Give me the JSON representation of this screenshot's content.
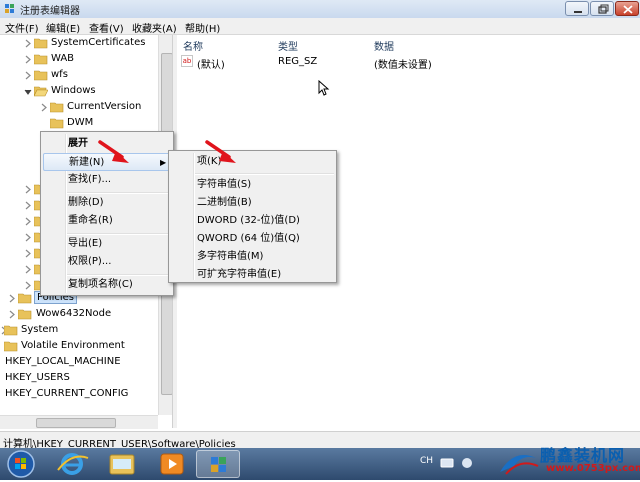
{
  "window": {
    "title": "注册表编辑器",
    "buttons": [
      "minimize",
      "maximize",
      "close"
    ]
  },
  "menubar": {
    "items": [
      "文件(F)",
      "编辑(E)",
      "查看(V)",
      "收藏夹(A)",
      "帮助(H)"
    ]
  },
  "tree": {
    "nodes": [
      {
        "label": "SystemCertificates"
      },
      {
        "label": "WAB"
      },
      {
        "label": "wfs"
      },
      {
        "label": "Windows"
      },
      {
        "label": "CurrentVersion"
      },
      {
        "label": "DWM"
      },
      {
        "label": "Policies"
      },
      {
        "label": "Wow6432Node"
      },
      {
        "label": "System"
      },
      {
        "label": "Volatile Environment"
      },
      {
        "label": "HKEY_LOCAL_MACHINE"
      },
      {
        "label": "HKEY_USERS"
      },
      {
        "label": "HKEY_CURRENT_CONFIG"
      }
    ]
  },
  "list": {
    "columns": [
      "名称",
      "类型",
      "数据"
    ],
    "rows": [
      {
        "name": "(默认)",
        "type": "REG_SZ",
        "data": "(数值未设置)"
      }
    ]
  },
  "context_menu": {
    "items": [
      "展开",
      "新建(N)",
      "查找(F)...",
      "删除(D)",
      "重命名(R)",
      "导出(E)",
      "权限(P)...",
      "复制项名称(C)"
    ]
  },
  "submenu": {
    "items": [
      "项(K)",
      "字符串值(S)",
      "二进制值(B)",
      "DWORD (32-位)值(D)",
      "QWORD (64 位)值(Q)",
      "多字符串值(M)",
      "可扩充字符串值(E)"
    ]
  },
  "statusbar": {
    "path": "计算机\\HKEY_CURRENT_USER\\Software\\Policies"
  },
  "taskbar": {
    "tray_lang": "CH"
  },
  "watermark": {
    "title": "鹏鑫装机网",
    "url": "www.0753px.com"
  },
  "colors": {
    "selection": "#cce3fb",
    "highlight_border": "#a8c6ec",
    "arrow": "#e0141c"
  }
}
